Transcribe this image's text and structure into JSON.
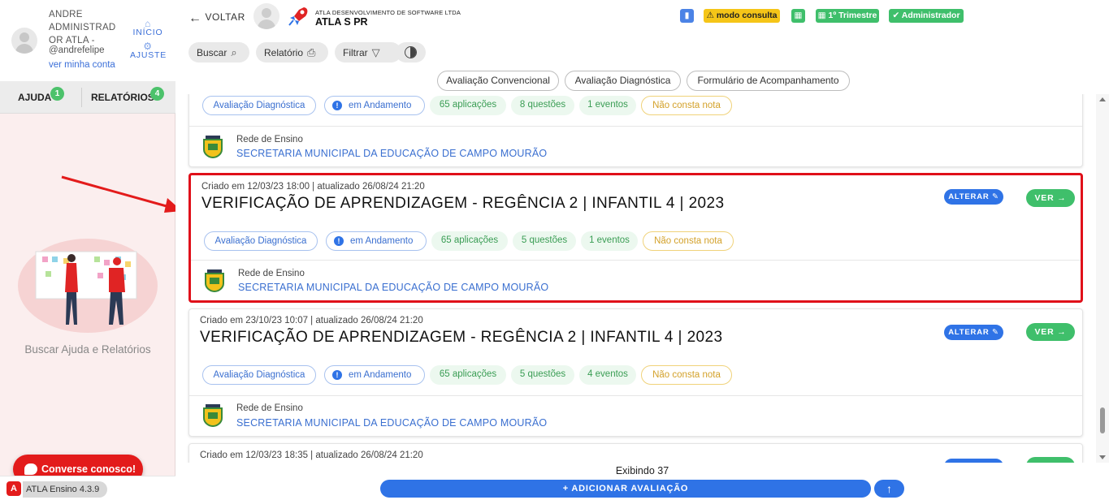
{
  "user": {
    "name": "ANDRE ADMINISTRAD OR ATLA -",
    "handle": "@andrefelipe",
    "account_link": "ver minha conta"
  },
  "side_nav": {
    "inicio": "INÍCIO",
    "ajuste": "AJUSTE"
  },
  "side_tabs": [
    {
      "label": "AJUDA",
      "badge": "1"
    },
    {
      "label": "RELATÓRIOS",
      "badge": "4"
    }
  ],
  "help_label": "Buscar Ajuda e Relatórios",
  "chat_label": "Converse conosco!",
  "version": {
    "logo": "A",
    "label": "ATLA Ensino 4.3.9"
  },
  "header": {
    "back_label": "VOLTAR",
    "org_subtitle": "ATLA DESENVOLVIMENTO DE SOFTWARE LTDA",
    "org_name": "ATLA S PR",
    "badges": {
      "consulta": "⚠ modo consulta",
      "trimestre": "1º Trimestre",
      "admin": "Administrador"
    }
  },
  "toolbar": {
    "buscar": "Buscar",
    "relatorio": "Relatório",
    "filtrar": "Filtrar"
  },
  "type_tabs": [
    "Avaliação Convencional",
    "Avaliação Diagnóstica",
    "Formulário de Acompanhamento"
  ],
  "card_buttons": {
    "alterar": "ALTERAR",
    "ver": "VER"
  },
  "network_label": "Rede de Ensino",
  "cards": [
    {
      "meta": "",
      "title": "",
      "chips": {
        "type": "Avaliação Diagnóstica",
        "status": "em Andamento",
        "aplicacoes": "65 aplicações",
        "questoes": "8 questões",
        "eventos": "1 eventos",
        "nota": "Não consta nota"
      },
      "network": "SECRETARIA MUNICIPAL DA EDUCAÇÃO DE CAMPO MOURÃO"
    },
    {
      "meta": "Criado em 12/03/23 18:00 | atualizado 26/08/24 21:20",
      "title": "VERIFICAÇÃO DE APRENDIZAGEM - REGÊNCIA 2 | INFANTIL 4 | 2023",
      "chips": {
        "type": "Avaliação Diagnóstica",
        "status": "em Andamento",
        "aplicacoes": "65 aplicações",
        "questoes": "5 questões",
        "eventos": "1 eventos",
        "nota": "Não consta nota"
      },
      "network": "SECRETARIA MUNICIPAL DA EDUCAÇÃO DE CAMPO MOURÃO"
    },
    {
      "meta": "Criado em 23/10/23 10:07 | atualizado 26/08/24 21:20",
      "title": "VERIFICAÇÃO DE APRENDIZAGEM - REGÊNCIA 2 | INFANTIL 4 | 2023",
      "chips": {
        "type": "Avaliação Diagnóstica",
        "status": "em Andamento",
        "aplicacoes": "65 aplicações",
        "questoes": "5 questões",
        "eventos": "4 eventos",
        "nota": "Não consta nota"
      },
      "network": "SECRETARIA MUNICIPAL DA EDUCAÇÃO DE CAMPO MOURÃO"
    },
    {
      "meta": "Criado em 12/03/23 18:35 | atualizado 26/08/24 21:20",
      "title": "",
      "chips": {},
      "network": ""
    }
  ],
  "footer": {
    "count": "Exibindo 37",
    "add_label": "+ ADICIONAR AVALIAÇÃO",
    "up_label": "↑"
  },
  "colors": {
    "primary": "#2f73e6",
    "success": "#3fbf6b",
    "warning": "#f5c518",
    "highlight": "#e0101a",
    "chat": "#e31b1b"
  }
}
